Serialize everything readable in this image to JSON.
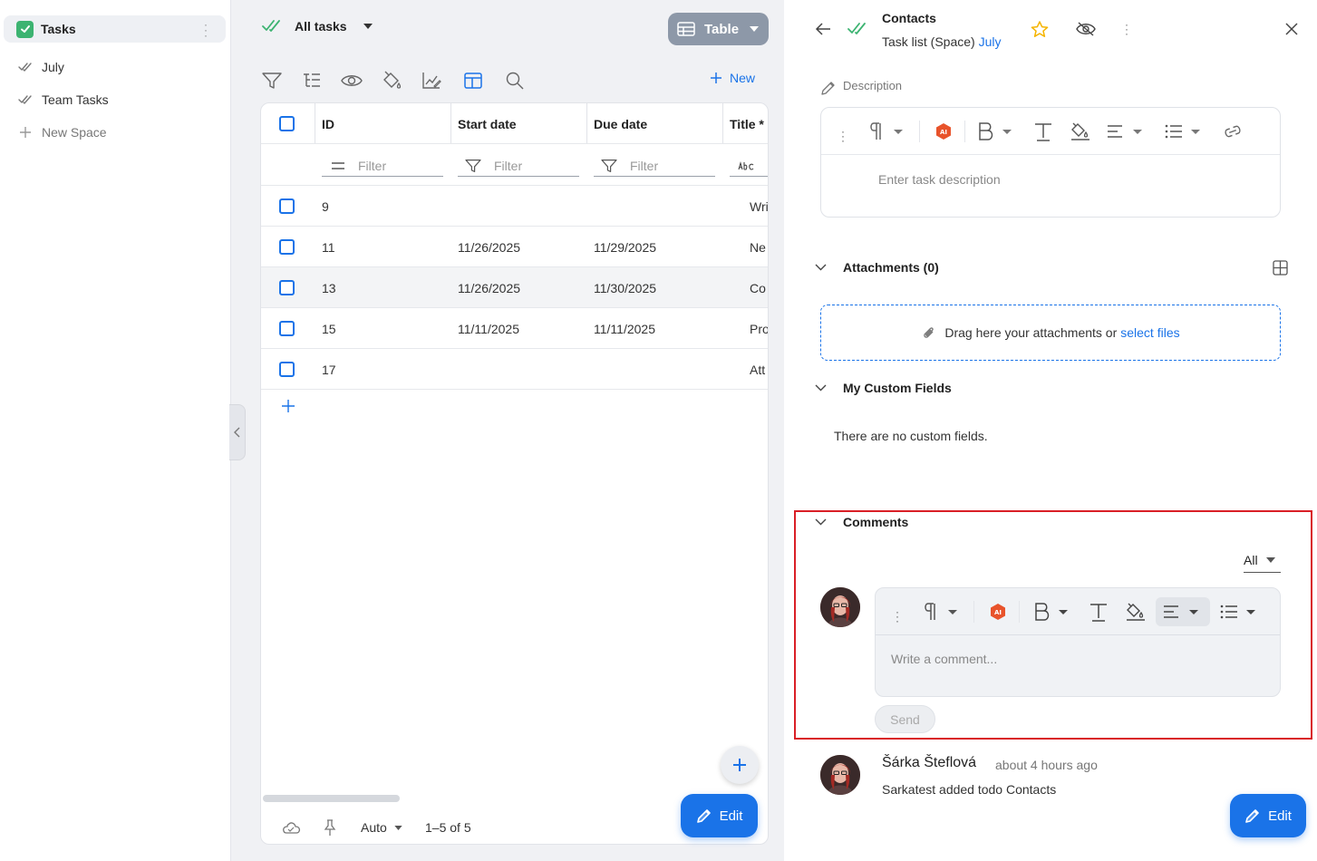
{
  "sidebar": {
    "top_label": "Tasks",
    "items": [
      {
        "label": "July"
      },
      {
        "label": "Team Tasks"
      },
      {
        "label": "New Space"
      }
    ]
  },
  "middle": {
    "view_title": "All tasks",
    "view_switcher_label": "Table",
    "new_label": "New",
    "columns": [
      "ID",
      "Start date",
      "Due date",
      "Title *"
    ],
    "filter_placeholder": "Filter",
    "rows": [
      {
        "id": "9",
        "start": "",
        "due": "",
        "title": "Wri"
      },
      {
        "id": "11",
        "start": "11/26/2025",
        "due": "11/29/2025",
        "title": "Ne"
      },
      {
        "id": "13",
        "start": "11/26/2025",
        "due": "11/30/2025",
        "title": "Co"
      },
      {
        "id": "15",
        "start": "11/11/2025",
        "due": "11/11/2025",
        "title": "Pro"
      },
      {
        "id": "17",
        "start": "",
        "due": "",
        "title": "Att"
      }
    ],
    "footer": {
      "mode": "Auto",
      "range": "1–5 of 5"
    },
    "edit_label": "Edit"
  },
  "detail": {
    "title": "Contacts",
    "subtitle_prefix": "Task list (Space)",
    "subtitle_link": "July",
    "description_label": "Description",
    "description_placeholder": "Enter task description",
    "attachments_label": "Attachments (0)",
    "drop_text": "Drag here your attachments or",
    "drop_link": "select files",
    "custom_fields_label": "My Custom Fields",
    "custom_fields_empty": "There are no custom fields.",
    "comments_label": "Comments",
    "comments_filter": "All",
    "comment_placeholder": "Write a comment...",
    "send_label": "Send",
    "activity": {
      "user": "Šárka Šteflová",
      "time": "about 4 hours ago",
      "text": "Sarkatest added todo Contacts"
    },
    "edit_label": "Edit"
  },
  "colors": {
    "accent": "#1a73e8",
    "success": "#3cb371",
    "star": "#f5b400",
    "ai_badge": "#e8532b",
    "highlight": "#d91f26"
  }
}
